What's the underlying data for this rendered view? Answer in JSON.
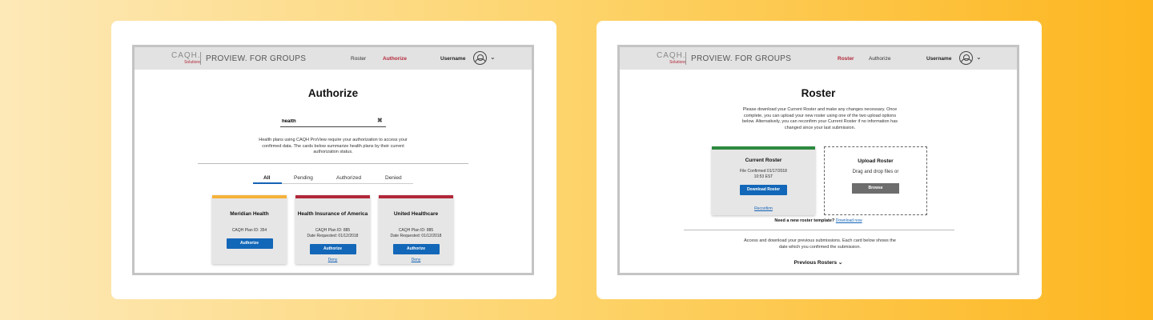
{
  "brand": {
    "logo": "CAQH.",
    "logo_sub": "Solutions",
    "product": "PROVIEW. FOR GROUPS"
  },
  "colors": {
    "accent_red": "#b2283a",
    "accent_blue": "#1367b8",
    "pending_yellow": "#f5b23a",
    "success_green": "#2e8a3f"
  },
  "authorize_screen": {
    "nav": {
      "roster": "Roster",
      "authorize": "Authorize",
      "username": "Username"
    },
    "title": "Authorize",
    "search": {
      "value": "health"
    },
    "intro": "Health plans using CAQH ProView require your authorization to access your confirmed data. The cards below summarize health plans by their current authorization status.",
    "tabs": [
      "All",
      "Pending",
      "Authorized",
      "Denied"
    ],
    "plans": [
      {
        "name": "Meridian Health",
        "plan_id": "CAQH Plan ID: 354",
        "date": "",
        "button": "Authorize",
        "deny": "",
        "status_color": "#f5b23a"
      },
      {
        "name": "Health Insurance of America",
        "plan_id": "CAQH Plan ID: 885",
        "date": "Date Requested: 01/12/2018",
        "button": "Authorize",
        "deny": "Deny",
        "status_color": "#b2283a"
      },
      {
        "name": "United Healthcare",
        "plan_id": "CAQH Plan ID: 885",
        "date": "Date Requested: 01/12/2018",
        "button": "Authorize",
        "deny": "Deny",
        "status_color": "#b2283a"
      }
    ]
  },
  "roster_screen": {
    "nav": {
      "roster": "Roster",
      "authorize": "Authorize",
      "username": "Username"
    },
    "title": "Roster",
    "intro": "Please download your Current Roster and make any changes necessary. Once complete, you can upload your new roster using one of the two upload options below. Alternatively, you can reconfirm your Current Roster if no information has changed since your last submission.",
    "current": {
      "title": "Current Roster",
      "confirmed": "File Confirmed 01/17/2018",
      "time": "10:53 EST",
      "button": "Download Roster",
      "reconfirm": "Reconfirm"
    },
    "upload": {
      "title": "Upload Roster",
      "drag": "Drag and drop files or",
      "button": "Browse"
    },
    "template": {
      "text": "Need a new roster template?",
      "link": "Download now"
    },
    "previous_intro": "Access and download your previous submissions. Each card below shows the date which you confirmed the submission.",
    "previous_label": "Previous Rosters",
    "previous_icon": "chevron-down-icon"
  }
}
